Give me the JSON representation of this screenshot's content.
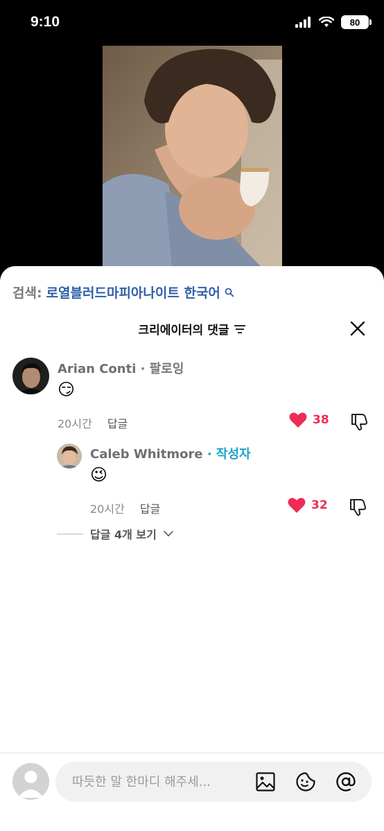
{
  "status_bar": {
    "time": "9:10",
    "battery": "80"
  },
  "search": {
    "prefix": "검색:",
    "term": "로열블러드마피아나이트 한국어"
  },
  "sheet": {
    "title": "크리에이터의 댓글"
  },
  "comments": [
    {
      "user": "Arian Conti",
      "relation": " · 팔로잉",
      "text": "😏",
      "time": "20시간",
      "reply_label": "답글",
      "likes": "38"
    }
  ],
  "reply": {
    "user": "Caleb Whitmore",
    "relation": " · 작성자",
    "text": "😉",
    "time": "20시간",
    "reply_label": "답글",
    "likes": "32"
  },
  "view_replies": {
    "label": "답글 4개 보기"
  },
  "input": {
    "placeholder": "따듯한 말 한마디 해주세..."
  },
  "colors": {
    "like": "#ee2c55",
    "link": "#2f5fa8",
    "author_badge": "#1aa3c9"
  },
  "icons": [
    "signal-icon",
    "wifi-icon",
    "battery-icon",
    "search-icon",
    "filter-icon",
    "close-icon",
    "heart-icon",
    "dislike-icon",
    "chevron-down-icon",
    "image-icon",
    "sticker-icon",
    "mention-icon"
  ]
}
